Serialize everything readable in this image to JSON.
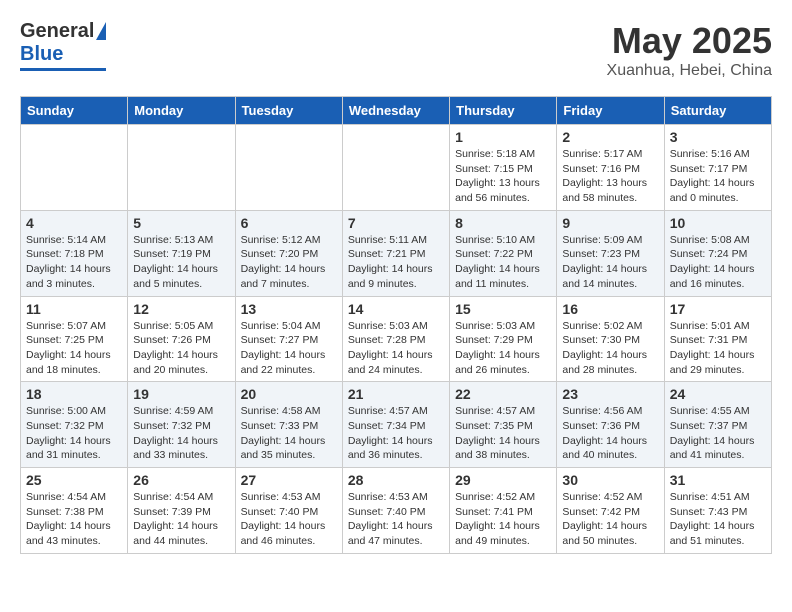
{
  "header": {
    "logo": {
      "general": "General",
      "blue": "Blue"
    },
    "month": "May 2025",
    "location": "Xuanhua, Hebei, China"
  },
  "weekdays": [
    "Sunday",
    "Monday",
    "Tuesday",
    "Wednesday",
    "Thursday",
    "Friday",
    "Saturday"
  ],
  "weeks": [
    [
      {
        "day": "",
        "detail": ""
      },
      {
        "day": "",
        "detail": ""
      },
      {
        "day": "",
        "detail": ""
      },
      {
        "day": "",
        "detail": ""
      },
      {
        "day": "1",
        "detail": "Sunrise: 5:18 AM\nSunset: 7:15 PM\nDaylight: 13 hours\nand 56 minutes."
      },
      {
        "day": "2",
        "detail": "Sunrise: 5:17 AM\nSunset: 7:16 PM\nDaylight: 13 hours\nand 58 minutes."
      },
      {
        "day": "3",
        "detail": "Sunrise: 5:16 AM\nSunset: 7:17 PM\nDaylight: 14 hours\nand 0 minutes."
      }
    ],
    [
      {
        "day": "4",
        "detail": "Sunrise: 5:14 AM\nSunset: 7:18 PM\nDaylight: 14 hours\nand 3 minutes."
      },
      {
        "day": "5",
        "detail": "Sunrise: 5:13 AM\nSunset: 7:19 PM\nDaylight: 14 hours\nand 5 minutes."
      },
      {
        "day": "6",
        "detail": "Sunrise: 5:12 AM\nSunset: 7:20 PM\nDaylight: 14 hours\nand 7 minutes."
      },
      {
        "day": "7",
        "detail": "Sunrise: 5:11 AM\nSunset: 7:21 PM\nDaylight: 14 hours\nand 9 minutes."
      },
      {
        "day": "8",
        "detail": "Sunrise: 5:10 AM\nSunset: 7:22 PM\nDaylight: 14 hours\nand 11 minutes."
      },
      {
        "day": "9",
        "detail": "Sunrise: 5:09 AM\nSunset: 7:23 PM\nDaylight: 14 hours\nand 14 minutes."
      },
      {
        "day": "10",
        "detail": "Sunrise: 5:08 AM\nSunset: 7:24 PM\nDaylight: 14 hours\nand 16 minutes."
      }
    ],
    [
      {
        "day": "11",
        "detail": "Sunrise: 5:07 AM\nSunset: 7:25 PM\nDaylight: 14 hours\nand 18 minutes."
      },
      {
        "day": "12",
        "detail": "Sunrise: 5:05 AM\nSunset: 7:26 PM\nDaylight: 14 hours\nand 20 minutes."
      },
      {
        "day": "13",
        "detail": "Sunrise: 5:04 AM\nSunset: 7:27 PM\nDaylight: 14 hours\nand 22 minutes."
      },
      {
        "day": "14",
        "detail": "Sunrise: 5:03 AM\nSunset: 7:28 PM\nDaylight: 14 hours\nand 24 minutes."
      },
      {
        "day": "15",
        "detail": "Sunrise: 5:03 AM\nSunset: 7:29 PM\nDaylight: 14 hours\nand 26 minutes."
      },
      {
        "day": "16",
        "detail": "Sunrise: 5:02 AM\nSunset: 7:30 PM\nDaylight: 14 hours\nand 28 minutes."
      },
      {
        "day": "17",
        "detail": "Sunrise: 5:01 AM\nSunset: 7:31 PM\nDaylight: 14 hours\nand 29 minutes."
      }
    ],
    [
      {
        "day": "18",
        "detail": "Sunrise: 5:00 AM\nSunset: 7:32 PM\nDaylight: 14 hours\nand 31 minutes."
      },
      {
        "day": "19",
        "detail": "Sunrise: 4:59 AM\nSunset: 7:32 PM\nDaylight: 14 hours\nand 33 minutes."
      },
      {
        "day": "20",
        "detail": "Sunrise: 4:58 AM\nSunset: 7:33 PM\nDaylight: 14 hours\nand 35 minutes."
      },
      {
        "day": "21",
        "detail": "Sunrise: 4:57 AM\nSunset: 7:34 PM\nDaylight: 14 hours\nand 36 minutes."
      },
      {
        "day": "22",
        "detail": "Sunrise: 4:57 AM\nSunset: 7:35 PM\nDaylight: 14 hours\nand 38 minutes."
      },
      {
        "day": "23",
        "detail": "Sunrise: 4:56 AM\nSunset: 7:36 PM\nDaylight: 14 hours\nand 40 minutes."
      },
      {
        "day": "24",
        "detail": "Sunrise: 4:55 AM\nSunset: 7:37 PM\nDaylight: 14 hours\nand 41 minutes."
      }
    ],
    [
      {
        "day": "25",
        "detail": "Sunrise: 4:54 AM\nSunset: 7:38 PM\nDaylight: 14 hours\nand 43 minutes."
      },
      {
        "day": "26",
        "detail": "Sunrise: 4:54 AM\nSunset: 7:39 PM\nDaylight: 14 hours\nand 44 minutes."
      },
      {
        "day": "27",
        "detail": "Sunrise: 4:53 AM\nSunset: 7:40 PM\nDaylight: 14 hours\nand 46 minutes."
      },
      {
        "day": "28",
        "detail": "Sunrise: 4:53 AM\nSunset: 7:40 PM\nDaylight: 14 hours\nand 47 minutes."
      },
      {
        "day": "29",
        "detail": "Sunrise: 4:52 AM\nSunset: 7:41 PM\nDaylight: 14 hours\nand 49 minutes."
      },
      {
        "day": "30",
        "detail": "Sunrise: 4:52 AM\nSunset: 7:42 PM\nDaylight: 14 hours\nand 50 minutes."
      },
      {
        "day": "31",
        "detail": "Sunrise: 4:51 AM\nSunset: 7:43 PM\nDaylight: 14 hours\nand 51 minutes."
      }
    ]
  ]
}
